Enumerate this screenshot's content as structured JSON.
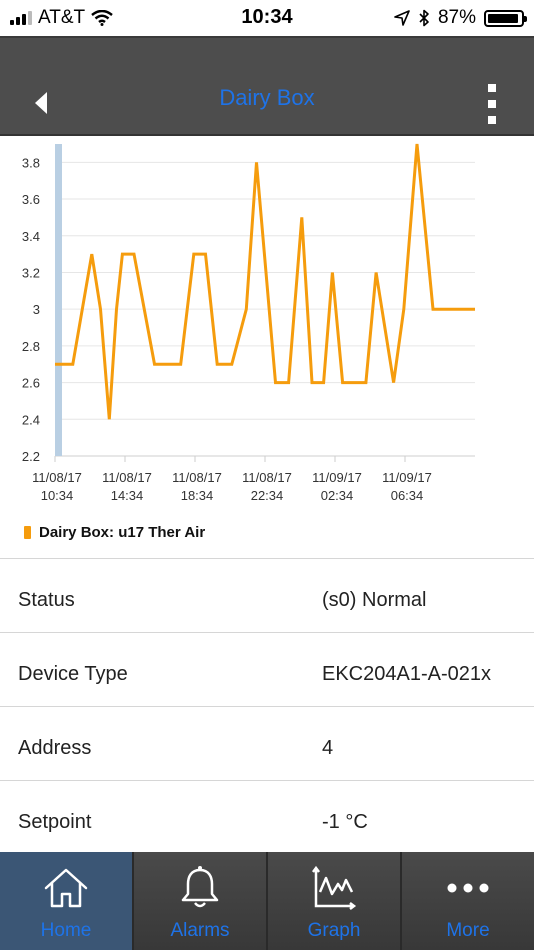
{
  "status_bar": {
    "carrier": "AT&T",
    "time": "10:34",
    "battery": "87%"
  },
  "header": {
    "title": "Dairy Box"
  },
  "chart_data": {
    "type": "line",
    "title": "",
    "xlabel": "",
    "ylabel": "",
    "ylim": [
      2.2,
      3.9
    ],
    "y_ticks": [
      "2.2",
      "2.4",
      "2.6",
      "2.8",
      "3",
      "3.2",
      "3.4",
      "3.6",
      "3.8"
    ],
    "x_ticks": [
      {
        "date": "11/08/17",
        "time": "10:34"
      },
      {
        "date": "11/08/17",
        "time": "14:34"
      },
      {
        "date": "11/08/17",
        "time": "18:34"
      },
      {
        "date": "11/08/17",
        "time": "22:34"
      },
      {
        "date": "11/09/17",
        "time": "02:34"
      },
      {
        "date": "11/09/17",
        "time": "06:34"
      }
    ],
    "series": [
      {
        "name": "Dairy Box:  u17 Ther Air",
        "color": "#f59c0d",
        "x": [
          "11/08/17 10:34",
          "11/08/17 11:35",
          "11/08/17 12:40",
          "11/08/17 13:10",
          "11/08/17 13:40",
          "11/08/17 14:05",
          "11/08/17 14:25",
          "11/08/17 15:05",
          "11/08/17 16:15",
          "11/08/17 17:45",
          "11/08/17 18:30",
          "11/08/17 19:10",
          "11/08/17 19:50",
          "11/08/17 20:10",
          "11/08/17 20:40",
          "11/08/17 21:30",
          "11/08/17 22:05",
          "11/08/17 23:10",
          "11/08/17 23:55",
          "11/09/17 00:40",
          "11/09/17 01:15",
          "11/09/17 01:55",
          "11/09/17 02:25",
          "11/09/17 03:00",
          "11/09/17 04:20",
          "11/09/17 04:55",
          "11/09/17 05:55",
          "11/09/17 06:30",
          "11/09/17 07:15",
          "11/09/17 08:10",
          "11/09/17 08:40",
          "11/09/17 10:34"
        ],
        "values": [
          2.7,
          2.7,
          3.3,
          3.0,
          2.4,
          3.0,
          3.3,
          3.3,
          2.7,
          2.7,
          3.3,
          3.3,
          2.7,
          2.7,
          2.7,
          3.0,
          3.8,
          2.6,
          2.6,
          3.5,
          2.6,
          2.6,
          3.2,
          2.6,
          2.6,
          3.2,
          2.6,
          3.0,
          3.9,
          3.0,
          3.0,
          3.0
        ]
      }
    ],
    "grid": true,
    "legend_position": "bottom-left"
  },
  "legend": {
    "label": "Dairy Box:  u17 Ther Air"
  },
  "details": [
    {
      "key": "Status",
      "value": "(s0) Normal"
    },
    {
      "key": "Device Type",
      "value": "EKC204A1-A-021x"
    },
    {
      "key": "Address",
      "value": "4"
    },
    {
      "key": "Setpoint",
      "value": "-1 °C"
    }
  ],
  "tabs": [
    {
      "label": "Home",
      "icon": "home-icon",
      "active": true
    },
    {
      "label": "Alarms",
      "icon": "bell-icon",
      "active": false
    },
    {
      "label": "Graph",
      "icon": "graph-icon",
      "active": false
    },
    {
      "label": "More",
      "icon": "more-icon",
      "active": false
    }
  ],
  "colors": {
    "accent": "#1e73e8",
    "series": "#f59c0d",
    "nav_bg": "#4d4d4d",
    "active_tab": "#3b5675"
  }
}
